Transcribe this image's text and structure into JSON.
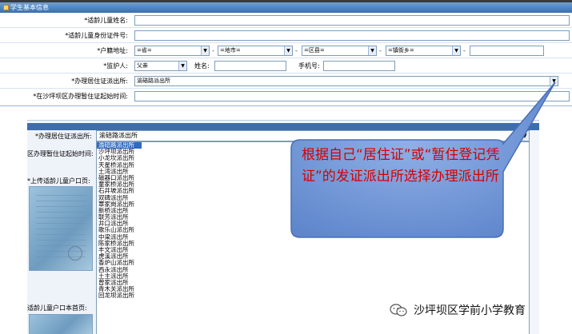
{
  "panel": {
    "title": "学生基本信息"
  },
  "form": {
    "name_label": "*适龄儿童姓名:",
    "id_label": "*适龄儿童身份证件号:",
    "hukou_label": "*户籍地址:",
    "province_value": "=省=",
    "city_value": "=地市=",
    "district_value": "=区县=",
    "town_value": "=镇街乡=",
    "separator": "-",
    "guardian_label": "*监护人:",
    "guardian_value": "父亲",
    "guardian_name_label": "姓名:",
    "phone_label": "手机号:",
    "police_station_label": "*办理居住证派出所:",
    "police_station_value": "渝碚路派出所",
    "start_time_label": "*在沙坪坝区办理暂住证起始时间:"
  },
  "lower": {
    "police_station_label": "*办理居住证派出所:",
    "police_station_value": "渝碚路派出所",
    "start_time_label": "区办理暂住证起始时间:",
    "upload_label": "*上传适龄儿童户口页:",
    "upload_label_2": "适龄儿童户口本首页:"
  },
  "dropdown_options": [
    "渝碚路派出所",
    "沙坪坝派出所",
    "小龙坎派出所",
    "天星桥派出所",
    "土湾派出所",
    "磁器口派出所",
    "童家桥派出所",
    "石井坡派出所",
    "双碑派出所",
    "覃家岗派出所",
    "新桥派出所",
    "联芳派出所",
    "井口派出所",
    "歌乐山派出所",
    "中梁派出所",
    "陈家桥派出所",
    "丰文派出所",
    "虎溪派出所",
    "香炉山派出所",
    "西永派出所",
    "土主派出所",
    "曾家派出所",
    "青木关派出所",
    "回龙坝派出所"
  ],
  "callout": {
    "text": "根据自己“居住证”或“暂住登记凭证”的发证派出所选择办理派出所",
    "fill": "#6a8fd0",
    "text_color": "#d60000"
  },
  "watermark": {
    "text": "沙坪坝区学前小学教育",
    "icon": "wechat-icon"
  }
}
